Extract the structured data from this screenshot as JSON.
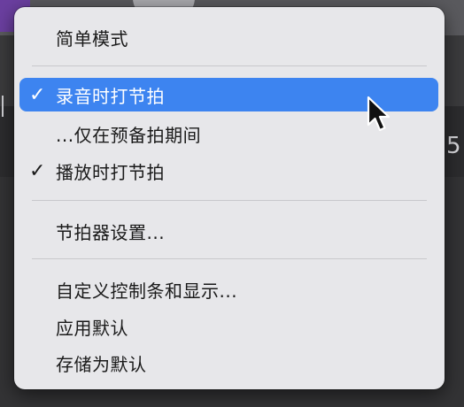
{
  "menu": {
    "items": [
      {
        "label": "简单模式",
        "checked": false
      },
      {
        "label": "录音时打节拍",
        "checked": true
      },
      {
        "label": "...仅在预备拍期间",
        "checked": false
      },
      {
        "label": "播放时打节拍",
        "checked": true
      },
      {
        "label": "节拍器设置...",
        "checked": false
      },
      {
        "label": "自定义控制条和显示...",
        "checked": false
      },
      {
        "label": "应用默认",
        "checked": false
      },
      {
        "label": "存储为默认",
        "checked": false
      }
    ],
    "check_glyph": "✓",
    "highlight_color": "#3d84f0"
  },
  "background": {
    "digit": "5"
  }
}
